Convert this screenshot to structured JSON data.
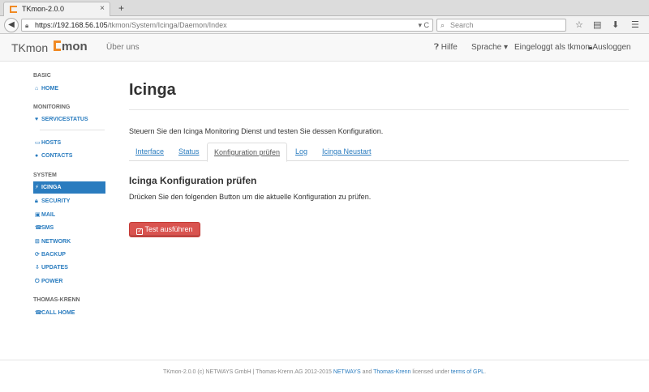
{
  "browser": {
    "tab_title": "TKmon-2.0.0",
    "tab_close": "×",
    "new_tab": "+",
    "url_host": "https://192.168.56.105",
    "url_path": "/tkmon/System/Icinga/Daemon/Index",
    "url_tools": "▾ C",
    "search_placeholder": "Search"
  },
  "app": {
    "brand": "TKmon",
    "logo_text": "mon",
    "about": "Über uns",
    "help": "Hilfe",
    "language": "Sprache",
    "logged_in": "Eingeloggt als tkmon",
    "logout": "Ausloggen"
  },
  "sidebar": {
    "basic_head": "BASIC",
    "home": "HOME",
    "monitoring_head": "MONITORING",
    "servicestatus": "SERVICESTATUS",
    "hosts": "HOSTS",
    "contacts": "CONTACTS",
    "system_head": "SYSTEM",
    "icinga": "ICINGA",
    "security": "SECURITY",
    "mail": "MAIL",
    "sms": "SMS",
    "network": "NETWORK",
    "backup": "BACKUP",
    "updates": "UPDATES",
    "power": "POWER",
    "thomas_head": "THOMAS-KRENN",
    "callhome": "CALL HOME"
  },
  "main": {
    "title": "Icinga",
    "description": "Steuern Sie den Icinga Monitoring Dienst und testen Sie dessen Konfiguration.",
    "tabs": [
      "Interface",
      "Status",
      "Konfiguration prüfen",
      "Log",
      "Icinga Neustart"
    ],
    "section_title": "Icinga Konfiguration prüfen",
    "section_text": "Drücken Sie den folgenden Button um die aktuelle Konfiguration zu prüfen.",
    "button_label": "Test ausführen"
  },
  "footer": {
    "text1": "TKmon-2.0.0 (c) NETWAYS GmbH | Thomas-Krenn.AG 2012-2015 ",
    "netways": "NETWAYS",
    "and": " and ",
    "thomas": "Thomas-Krenn",
    "licensed": " licensed under ",
    "gpl": "terms of GPL",
    "dot": "."
  },
  "colors": {
    "accent": "#2a7cbf",
    "danger": "#d9534f",
    "logo": "#f08a24"
  }
}
